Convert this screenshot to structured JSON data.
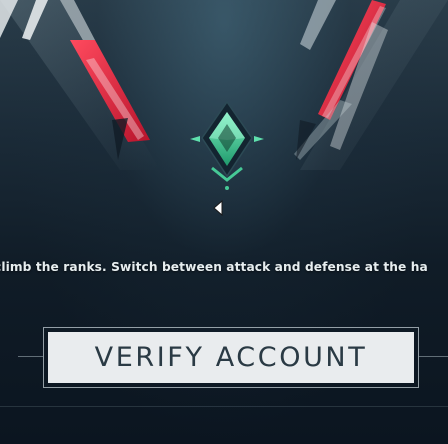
{
  "onboarding": {
    "description": "climb the ranks. Switch between attack and defense at the ha",
    "verify_button_label": "VERIFY ACCOUNT"
  },
  "colors": {
    "accent_red": "#e8334a",
    "rank_green": "#3ecf9a",
    "button_bg": "#e9ecee",
    "button_text": "#2a3a44"
  },
  "icons": {
    "rank_emblem": "ascendant-rank-icon",
    "cursor": "arrow-cursor-icon"
  }
}
